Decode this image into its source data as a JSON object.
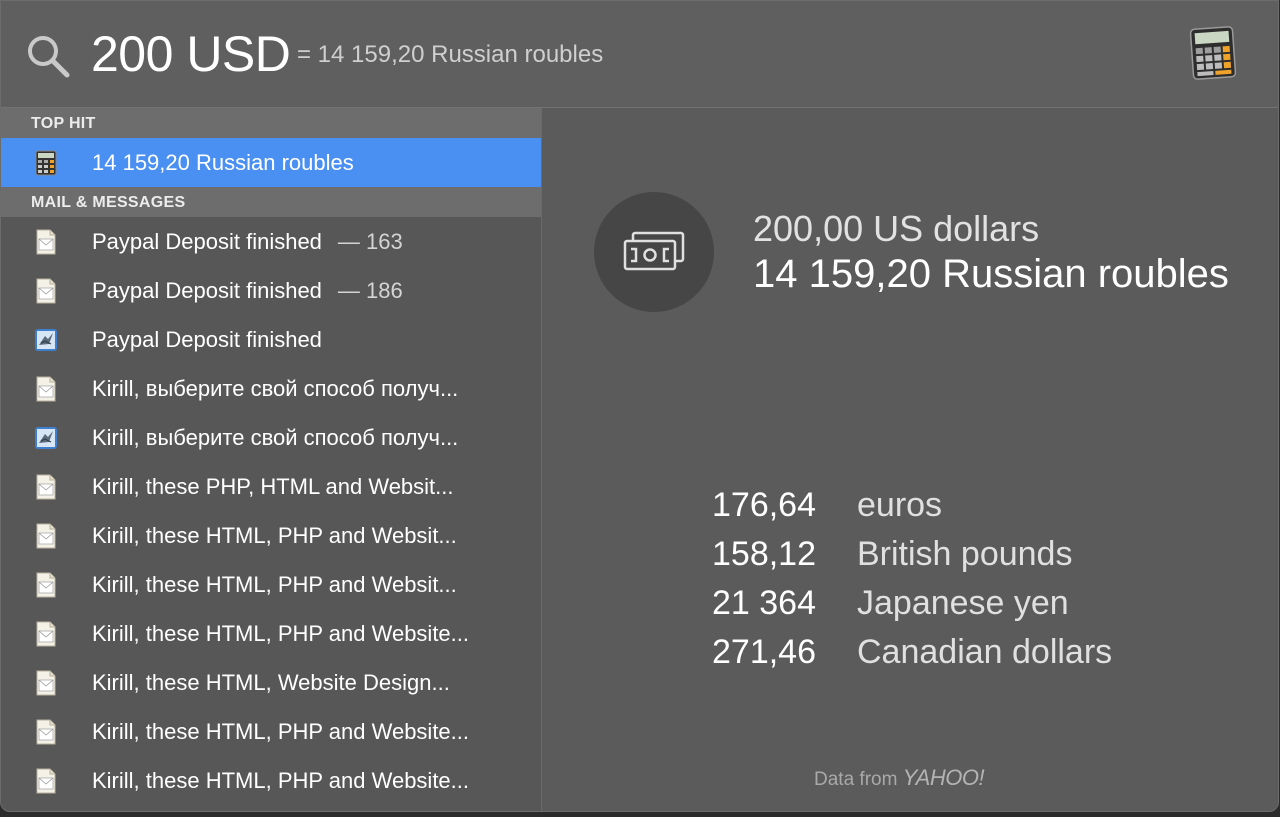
{
  "search": {
    "query": "200 USD",
    "inline_result": "= 14 159,20 Russian roubles"
  },
  "sections": [
    {
      "header": "TOP HIT",
      "items": [
        {
          "title": "14 159,20 Russian roubles",
          "meta": "",
          "icon": "calculator-icon",
          "selected": true
        }
      ]
    },
    {
      "header": "MAIL & MESSAGES",
      "items": [
        {
          "title": "Paypal Deposit finished",
          "meta": "— 163",
          "icon": "mail-message-icon"
        },
        {
          "title": "Paypal Deposit finished",
          "meta": "— 186",
          "icon": "mail-message-icon"
        },
        {
          "title": "Paypal Deposit finished",
          "meta": "",
          "icon": "mail-app-icon"
        },
        {
          "title": "Kirill, выберите свой способ получ...",
          "meta": "",
          "icon": "mail-message-icon"
        },
        {
          "title": "Kirill, выберите свой способ получ...",
          "meta": "",
          "icon": "mail-app-icon"
        },
        {
          "title": "Kirill, these PHP, HTML and Websit...",
          "meta": "",
          "icon": "mail-message-icon"
        },
        {
          "title": "Kirill, these HTML, PHP and Websit...",
          "meta": "",
          "icon": "mail-message-icon"
        },
        {
          "title": "Kirill, these HTML, PHP and Websit...",
          "meta": "",
          "icon": "mail-message-icon"
        },
        {
          "title": "Kirill, these HTML, PHP and Website...",
          "meta": "",
          "icon": "mail-message-icon"
        },
        {
          "title": "Kirill, these HTML, Website Design...",
          "meta": "",
          "icon": "mail-message-icon"
        },
        {
          "title": "Kirill, these HTML, PHP and Website...",
          "meta": "",
          "icon": "mail-message-icon"
        },
        {
          "title": "Kirill, these HTML, PHP and Website...",
          "meta": "",
          "icon": "mail-message-icon"
        }
      ]
    }
  ],
  "preview": {
    "from_amount": "200,00 US dollars",
    "to_amount": "14 159,20 Russian roubles",
    "rates": [
      {
        "value": "176,64",
        "currency": "euros"
      },
      {
        "value": "158,12",
        "currency": "British pounds"
      },
      {
        "value": "21 364",
        "currency": "Japanese yen"
      },
      {
        "value": "271,46",
        "currency": "Canadian dollars"
      }
    ],
    "source_label": "Data from",
    "source_name": "YAHOO!"
  },
  "colors": {
    "selection": "#4a90f2",
    "panel": "#5a5a5a",
    "section_header": "#6d6d6d"
  }
}
